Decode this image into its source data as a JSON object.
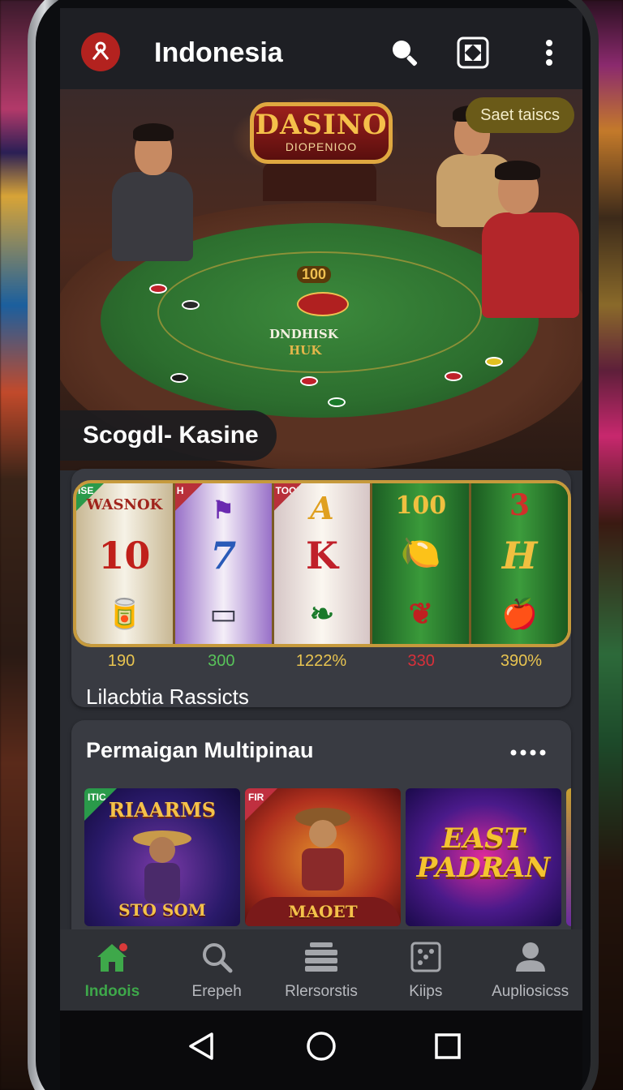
{
  "app": {
    "title": "Indonesia"
  },
  "hero": {
    "sign_title": "DASINO",
    "sign_subtitle": "DIOPENIOO",
    "felt_value": "100",
    "felt_name": "DNDHISK",
    "felt_sub": "HUK",
    "badge": "Saet taiscs",
    "caption": "Scogdl- Kasine"
  },
  "slots": {
    "reel_tags": [
      "ISE",
      "H",
      "TOOB"
    ],
    "reels": [
      {
        "top": "WASNOK",
        "mid": "10",
        "bottom": "🥫"
      },
      {
        "top": "⚑",
        "mid": "7",
        "bottom": "▭"
      },
      {
        "top": "A",
        "mid": "K",
        "bottom": "❧"
      },
      {
        "top": "100",
        "mid": "🍋",
        "bottom": "❦"
      },
      {
        "top": "3",
        "mid": "H",
        "bottom": "🍎"
      }
    ],
    "payouts": [
      {
        "value": "190",
        "color": "#e8c450"
      },
      {
        "value": "300",
        "color": "#58c35a"
      },
      {
        "value": "1222%",
        "color": "#e8c450"
      },
      {
        "value": "330",
        "color": "#d8303a"
      },
      {
        "value": "390%",
        "color": "#e8c450"
      }
    ],
    "label": "Lilacbtia Rassicts"
  },
  "multiplayer": {
    "title": "Permaigan Multipinau",
    "tiles": [
      {
        "tag": "ITIC",
        "top": "RIAARMS",
        "bottom": "STO SOM"
      },
      {
        "tag": "FIR",
        "top": "",
        "bottom": "MAOET"
      },
      {
        "tag": "",
        "top": "",
        "big": "EAST PADRAN"
      }
    ]
  },
  "nav": {
    "items": [
      {
        "label": "Indoois",
        "icon": "home-icon"
      },
      {
        "label": "Erepeh",
        "icon": "search-icon"
      },
      {
        "label": "Rlersorstis",
        "icon": "stack-icon"
      },
      {
        "label": "Kiips",
        "icon": "dice-icon"
      },
      {
        "label": "Aupliosicss",
        "icon": "person-icon"
      }
    ]
  },
  "colors": {
    "accent": "#3ea84a",
    "appbar": "#1e1f24",
    "card": "#393b42",
    "gold": "#c69a3c"
  }
}
